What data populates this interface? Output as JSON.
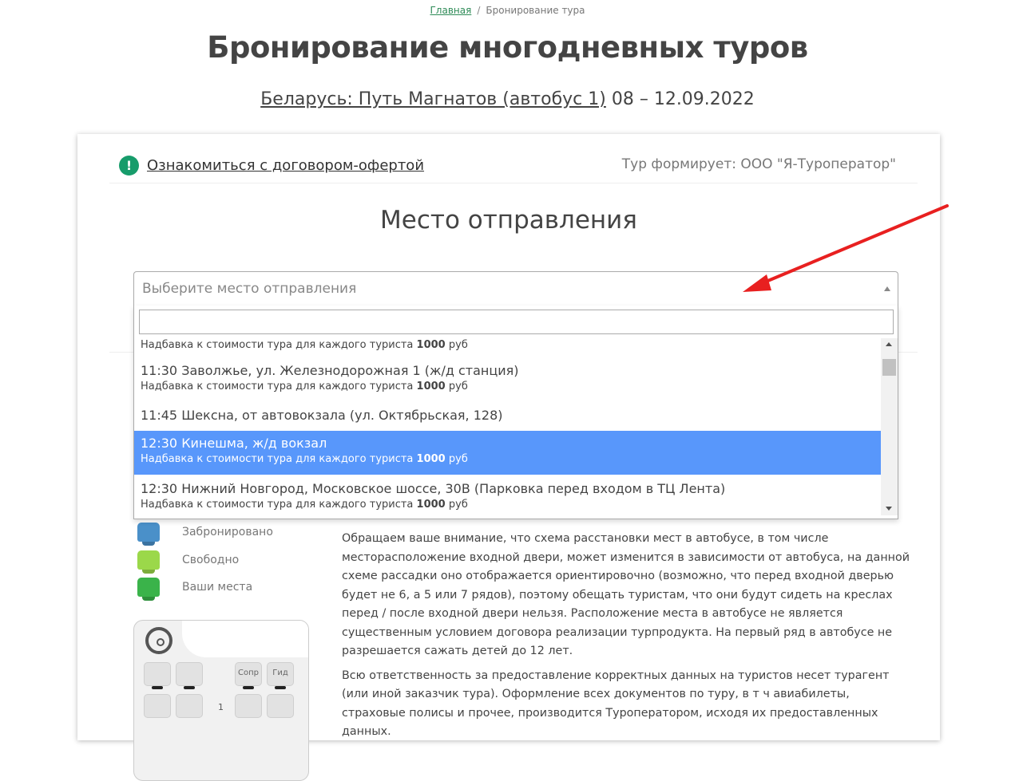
{
  "breadcrumb": {
    "home": "Главная",
    "separator": "/",
    "current": "Бронирование тура"
  },
  "page_title": "Бронирование многодневных туров",
  "tour": {
    "name": "Беларусь: Путь Магнатов (автобус 1)",
    "dates": "08 – 12.09.2022"
  },
  "card": {
    "contract_icon": "!",
    "contract_link": "Ознакомиться с договором-офертой",
    "operator": "Тур формирует: ООО \"Я-Туроператор\"",
    "section_title": "Место отправления"
  },
  "departure_select": {
    "placeholder": "Выберите место отправления",
    "search_value": "",
    "surcharge_prefix": "Надбавка к стоимости тура для каждого туриста",
    "surcharge_suffix": "руб",
    "options": [
      {
        "title": "",
        "surcharge": "1000"
      },
      {
        "title": "11:30 Заволжье, ул. Железнодорожная 1 (ж/д станция)",
        "surcharge": "1000"
      },
      {
        "title": "11:45 Шексна, от автовокзала (ул. Октябрьская, 128)",
        "surcharge": ""
      },
      {
        "title": "12:30 Кинешма, ж/д вокзал",
        "surcharge": "1000",
        "highlighted": true
      },
      {
        "title": "12:30 Нижний Новгород, Московское шоссе, 30В (Парковка перед входом в ТЦ Лента)",
        "surcharge": "1000"
      }
    ]
  },
  "legend": [
    {
      "label": "Забронировано",
      "color": "#4a90c9"
    },
    {
      "label": "Свободно",
      "color": "#9bd84a"
    },
    {
      "label": "Ваши места",
      "color": "#3ab34a"
    }
  ],
  "bus_scheme": {
    "seat_sopr": "Сопр",
    "seat_gid": "Гид",
    "row_label": "1"
  },
  "notes": [
    "Обращаем ваше внимание, что схема расстановки мест в автобусе, в том числе месторасположение входной двери, может изменится в зависимости от автобуса, на данной схеме рассадки оно отображается ориентировочно (возможно, что перед входной дверью будет не 6, а 5 или 7 рядов), поэтому обещать туристам, что они будут сидеть на креслах перед / после входной двери нельзя. Расположение места в автобусе не является существенным условием договора реализации турпродукта. На первый ряд в автобусе не разрешается сажать детей до 12 лет.",
    "Всю ответственность за предоставление корректных данных на туристов несет турагент (или иной заказчик тура). Оформление всех документов по туру, в т ч авиабилеты, страховые полисы и прочее, производится Туроператором, исходя их предоставленных данных."
  ],
  "colors": {
    "accent": "#2e8b57",
    "highlight": "#5897fb",
    "info_icon": "#179c6b",
    "annotation_arrow": "#e82020"
  }
}
